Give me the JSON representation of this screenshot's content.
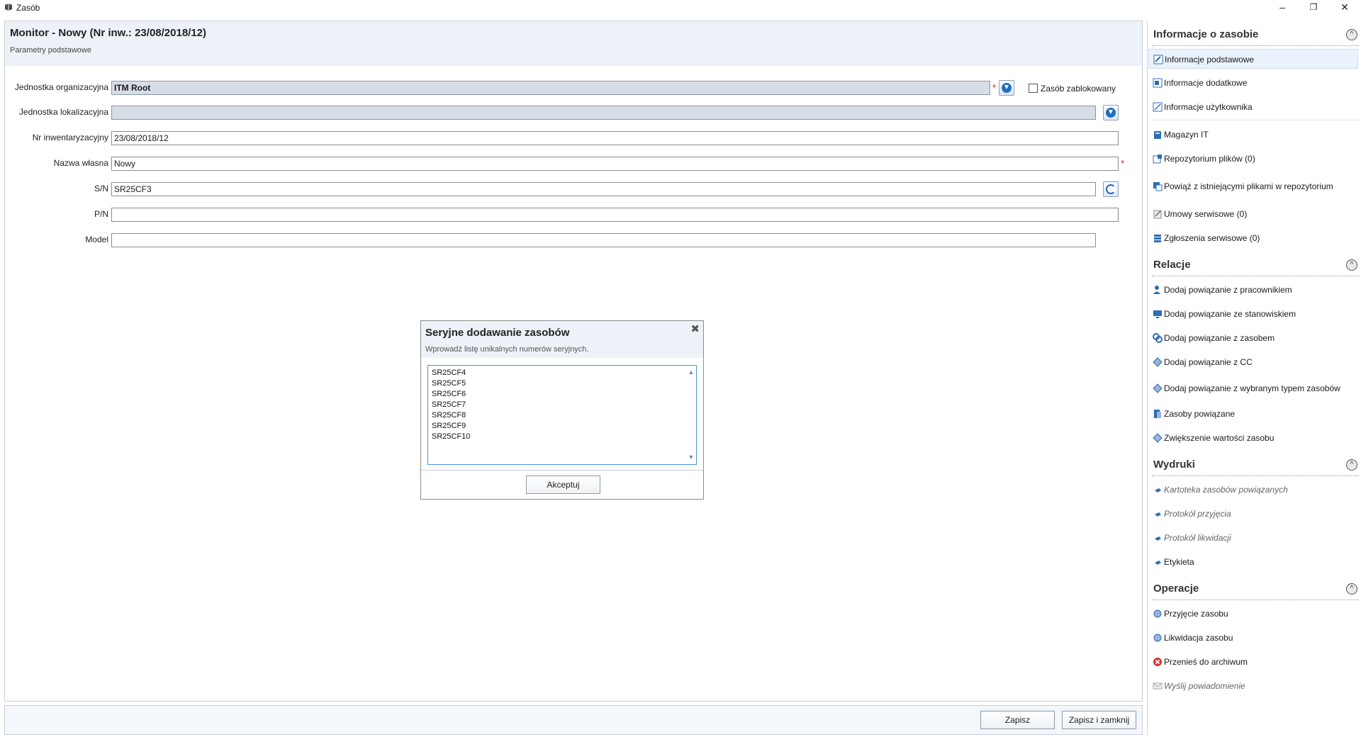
{
  "window": {
    "title": "Zasób",
    "buttons": {
      "minimize": "–",
      "restore": "❐",
      "close": "✕"
    }
  },
  "header": {
    "title": "Monitor - Nowy (Nr inw.: 23/08/2018/12)",
    "subtitle": "Parametry podstawowe"
  },
  "form": {
    "org_unit": {
      "label": "Jednostka organizacyjna",
      "value": "ITM Root"
    },
    "locked_label": "Zasób zablokowany",
    "loc_unit": {
      "label": "Jednostka lokalizacyjna",
      "value": ""
    },
    "inv_no": {
      "label": "Nr inwentaryzacyjny",
      "value": "23/08/2018/12"
    },
    "name": {
      "label": "Nazwa własna",
      "value": "Nowy"
    },
    "sn": {
      "label": "S/N",
      "value": "SR25CF3"
    },
    "pn": {
      "label": "P/N",
      "value": ""
    },
    "model": {
      "label": "Model",
      "value": ""
    },
    "required_mark": "*"
  },
  "modal": {
    "title": "Seryjne dodawanie zasobów",
    "description": "Wprowadź listę unikalnych numerów seryjnych.",
    "close_icon": "✖",
    "serials": [
      "SR25CF4",
      "SR25CF5",
      "SR25CF6",
      "SR25CF7",
      "SR25CF8",
      "SR25CF9",
      "SR25CF10"
    ],
    "accept_label": "Akceptuj"
  },
  "footer": {
    "save_label": "Zapisz",
    "save_close_label": "Zapisz i zamknij"
  },
  "sidebar": {
    "toggle_glyph": "^",
    "sections": {
      "info": {
        "title": "Informacje o zasobie",
        "items": [
          "Informacje podstawowe",
          "Informacje dodatkowe",
          "Informacje użytkownika",
          "Magazyn IT",
          "Repozytorium plików (0)",
          "Powiąż z istniejącymi plikami w repozytorium",
          "Umowy serwisowe (0)",
          "Zgłoszenia serwisowe (0)"
        ]
      },
      "relations": {
        "title": "Relacje",
        "items": [
          "Dodaj powiązanie z pracownikiem",
          "Dodaj powiązanie ze stanowiskiem",
          "Dodaj powiązanie z zasobem",
          "Dodaj powiązanie z CC",
          "Dodaj powiązanie z wybranym typem zasobów",
          "Zasoby powiązane",
          "Zwiększenie wartości zasobu"
        ]
      },
      "prints": {
        "title": "Wydruki",
        "items": [
          "Kartoteka zasobów powiązanych",
          "Protokół przyjęcia",
          "Protokół likwidacji",
          "Etykieta"
        ]
      },
      "operations": {
        "title": "Operacje",
        "items": [
          "Przyjęcie zasobu",
          "Likwidacja zasobu",
          "Przenieś do archiwum",
          "Wyślij powiadomienie"
        ]
      }
    }
  }
}
